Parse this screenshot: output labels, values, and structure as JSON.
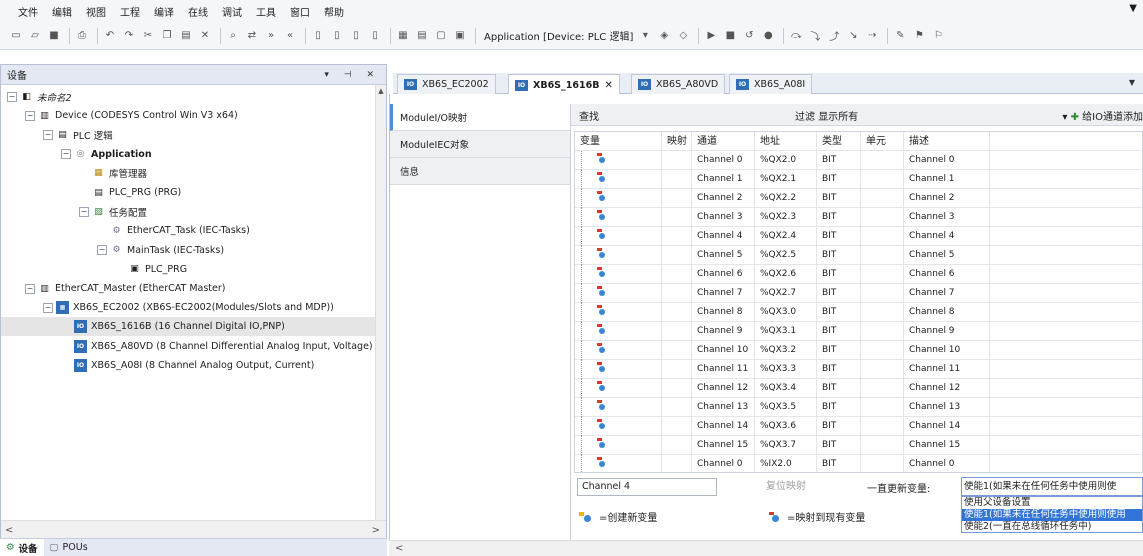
{
  "menu": [
    "文件",
    "编辑",
    "视图",
    "工程",
    "编译",
    "在线",
    "调试",
    "工具",
    "窗口",
    "帮助"
  ],
  "menu_corner_glyph": "▼",
  "toolbar": {
    "application_combo": "Application [Device: PLC 逻辑]",
    "combo_arrow": "▾",
    "icons_a": [
      "new-icon",
      "open-icon",
      "save-icon",
      "print-icon",
      "undo-icon",
      "redo-icon",
      "cut-icon",
      "copy-icon",
      "paste-icon",
      "delete-icon",
      "find-icon",
      "replace-icon",
      "find-next-icon",
      "find-prev-icon",
      "bookmark-icon",
      "bookmark-next-icon",
      "bookmark-prev-icon",
      "bookmark-clear-icon",
      "device-add-icon",
      "object-add-icon",
      "folder-add-icon",
      "application-icon"
    ],
    "icons_b": [
      "login-icon",
      "logout-icon",
      "run-icon",
      "stop-icon",
      "reset-icon",
      "breakpoint-icon",
      "step-over-icon",
      "step-into-icon",
      "step-out-icon",
      "run-to-cursor-icon",
      "next-statement-icon",
      "write-values-icon",
      "force-values-icon",
      "unforce-icon"
    ]
  },
  "left_pane": {
    "title": "设备",
    "header_icons": "▾ ⊣ ✕",
    "tree": [
      {
        "label": "未命名2",
        "icon": "project-icon",
        "expand": "−",
        "style": "ital"
      },
      {
        "label": "Device (CODESYS Control Win V3 x64)",
        "icon": "device-icon",
        "expand": "−",
        "style": ""
      },
      {
        "label": "PLC 逻辑",
        "icon": "plc-logic-icon",
        "expand": "−",
        "style": ""
      },
      {
        "label": "Application",
        "icon": "application-icon",
        "expand": "−",
        "style": "bold"
      },
      {
        "label": "库管理器",
        "icon": "library-icon",
        "expand": "",
        "style": ""
      },
      {
        "label": "PLC_PRG (PRG)",
        "icon": "program-icon",
        "expand": "",
        "style": ""
      },
      {
        "label": "任务配置",
        "icon": "task-config-icon",
        "expand": "−",
        "style": ""
      },
      {
        "label": "EtherCAT_Task (IEC-Tasks)",
        "icon": "task-icon",
        "expand": "",
        "style": ""
      },
      {
        "label": "MainTask (IEC-Tasks)",
        "icon": "task-icon",
        "expand": "−",
        "style": ""
      },
      {
        "label": "PLC_PRG",
        "icon": "program-call-icon",
        "expand": "",
        "style": ""
      },
      {
        "label": "EtherCAT_Master (EtherCAT Master)",
        "icon": "ethercat-master-icon",
        "expand": "−",
        "style": ""
      },
      {
        "label": "XB6S_EC2002 (XB6S-EC2002(Modules/Slots and MDP))",
        "icon": "coupler-icon",
        "expand": "−",
        "style": ""
      },
      {
        "label": "XB6S_1616B (16 Channel Digital IO,PNP)",
        "icon": "module-icon",
        "expand": "",
        "style": ""
      },
      {
        "label": "XB6S_A80VD (8 Channel Differential Analog Input, Voltage)",
        "icon": "module-icon",
        "expand": "",
        "style": ""
      },
      {
        "label": "XB6S_A08I (8 Channel Analog Output, Current)",
        "icon": "module-icon",
        "expand": "",
        "style": ""
      }
    ],
    "selected_index": 12,
    "scroll_up_glyph": "▲",
    "scroll_left_glyph": "<",
    "scroll_right_glyph": ">",
    "bottom_tabs": [
      {
        "label": "设备",
        "icon": "devices-tab-icon",
        "active": true
      },
      {
        "label": "POUs",
        "icon": "pous-tab-icon",
        "active": false
      }
    ]
  },
  "doc_tabs": [
    {
      "label": "XB6S_EC2002",
      "active": false,
      "closable": false
    },
    {
      "label": "XB6S_1616B",
      "active": true,
      "closable": true
    },
    {
      "label": "XB6S_A80VD",
      "active": false,
      "closable": false
    },
    {
      "label": "XB6S_A08I",
      "active": false,
      "closable": false
    }
  ],
  "doc_tab_icon_text": "IO",
  "doc_tab_close_glyph": "✕",
  "doc_tabs_dropdown_glyph": "▼",
  "side_tabs": [
    {
      "label": "ModuleI/O映射",
      "active": true
    },
    {
      "label": "ModuleIEC对象",
      "active": false
    },
    {
      "label": "信息",
      "active": false
    }
  ],
  "filterbar": {
    "find_label": "查找",
    "filter_label": "过滤",
    "filter_value": "显示所有",
    "dropdown_glyph": "▾",
    "add_plus_glyph": "✚",
    "add_label": "给IO通道添加"
  },
  "grid": {
    "columns": [
      "变量",
      "映射",
      "通道",
      "地址",
      "类型",
      "单元",
      "描述"
    ],
    "rows": [
      {
        "channel": "Channel 0",
        "address": "%QX2.0",
        "type": "BIT",
        "desc": "Channel 0"
      },
      {
        "channel": "Channel 1",
        "address": "%QX2.1",
        "type": "BIT",
        "desc": "Channel 1"
      },
      {
        "channel": "Channel 2",
        "address": "%QX2.2",
        "type": "BIT",
        "desc": "Channel 2"
      },
      {
        "channel": "Channel 3",
        "address": "%QX2.3",
        "type": "BIT",
        "desc": "Channel 3"
      },
      {
        "channel": "Channel 4",
        "address": "%QX2.4",
        "type": "BIT",
        "desc": "Channel 4"
      },
      {
        "channel": "Channel 5",
        "address": "%QX2.5",
        "type": "BIT",
        "desc": "Channel 5"
      },
      {
        "channel": "Channel 6",
        "address": "%QX2.6",
        "type": "BIT",
        "desc": "Channel 6"
      },
      {
        "channel": "Channel 7",
        "address": "%QX2.7",
        "type": "BIT",
        "desc": "Channel 7"
      },
      {
        "channel": "Channel 8",
        "address": "%QX3.0",
        "type": "BIT",
        "desc": "Channel 8"
      },
      {
        "channel": "Channel 9",
        "address": "%QX3.1",
        "type": "BIT",
        "desc": "Channel 9"
      },
      {
        "channel": "Channel 10",
        "address": "%QX3.2",
        "type": "BIT",
        "desc": "Channel 10"
      },
      {
        "channel": "Channel 11",
        "address": "%QX3.3",
        "type": "BIT",
        "desc": "Channel 11"
      },
      {
        "channel": "Channel 12",
        "address": "%QX3.4",
        "type": "BIT",
        "desc": "Channel 12"
      },
      {
        "channel": "Channel 13",
        "address": "%QX3.5",
        "type": "BIT",
        "desc": "Channel 13"
      },
      {
        "channel": "Channel 14",
        "address": "%QX3.6",
        "type": "BIT",
        "desc": "Channel 14"
      },
      {
        "channel": "Channel 15",
        "address": "%QX3.7",
        "type": "BIT",
        "desc": "Channel 15"
      },
      {
        "channel": "Channel 0",
        "address": "%IX2.0",
        "type": "BIT",
        "desc": "Channel 0"
      }
    ]
  },
  "bottom_bar": {
    "channel_value": "Channel 4",
    "reset_label": "复位映射",
    "update_label": "一直更新变量:",
    "update_selected": "使能1(如果未在任何任务中使用则使",
    "update_options": [
      {
        "label": "使用父设备设置",
        "selected": false
      },
      {
        "label": "使能1(如果未在任何任务中使用则使用",
        "selected": true
      },
      {
        "label": "使能2(一直在总线循环任务中)",
        "selected": false
      }
    ],
    "legend_new": "=创建新变量",
    "legend_existing": "=映射到现有变量"
  },
  "colors": {
    "accent": "#3375d6",
    "chrome": "#f4f6fa",
    "selection_gray": "#e5e5e5",
    "var_icon_blue": "#3a86d6",
    "var_icon_red": "#d43a2f"
  }
}
